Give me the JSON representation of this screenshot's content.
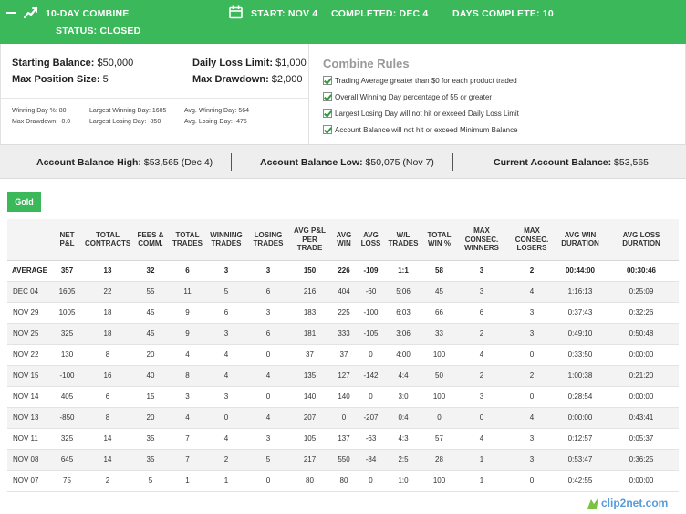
{
  "header": {
    "title": "10-DAY COMBINE",
    "status": "STATUS: CLOSED",
    "start": "START: NOV 4",
    "completed": "COMPLETED: DEC 4",
    "days_complete": "DAYS COMPLETE: 10"
  },
  "summary": {
    "starting_balance_label": "Starting Balance:",
    "starting_balance_value": " $50,000",
    "max_position_label": "Max Position Size:",
    "max_position_value": " 5",
    "daily_loss_label": "Daily Loss Limit:",
    "daily_loss_value": " $1,000",
    "max_drawdown_label": "Max Drawdown:",
    "max_drawdown_value": " $2,000",
    "winning_day_pct": "Winning Day %: 80",
    "max_drawdown_stat": "Max Drawdown: -0.0",
    "largest_winning_day": "Largest Winning Day: 1605",
    "largest_losing_day": "Largest Losing Day: -850",
    "avg_winning_day": "Avg. Winning Day: 564",
    "avg_losing_day": "Avg. Losing Day: -475"
  },
  "rules": {
    "title": "Combine Rules",
    "items": [
      "Trading Average greater than $0 for each product traded",
      "Overall Winning Day percentage of 55 or greater",
      "Largest Losing Day will not hit or exceed Daily Loss Limit",
      "Account Balance will not hit or exceed Minimum Balance"
    ]
  },
  "balances": {
    "high_label": "Account Balance High:",
    "high_value": " $53,565 (Dec 4)",
    "low_label": "Account Balance Low:",
    "low_value": " $50,075 (Nov 7)",
    "current_label": "Current Account Balance:",
    "current_value": " $53,565"
  },
  "product_button": "Gold",
  "table": {
    "headers": [
      "",
      "NET\nP&L",
      "TOTAL\nCONTRACTS",
      "FEES &\nCOMM.",
      "TOTAL\nTRADES",
      "WINNING\nTRADES",
      "LOSING\nTRADES",
      "AVG P&L\nPER\nTRADE",
      "AVG\nWIN",
      "AVG\nLOSS",
      "W/L\nTRADES",
      "TOTAL\nWIN %",
      "MAX\nCONSEC.\nWINNERS",
      "MAX\nCONSEC.\nLOSERS",
      "AVG WIN\nDURATION",
      "AVG LOSS\nDURATION"
    ],
    "rows": [
      [
        "AVERAGE",
        "357",
        "13",
        "32",
        "6",
        "3",
        "3",
        "150",
        "226",
        "-109",
        "1:1",
        "58",
        "3",
        "2",
        "00:44:00",
        "00:30:46"
      ],
      [
        "DEC 04",
        "1605",
        "22",
        "55",
        "11",
        "5",
        "6",
        "216",
        "404",
        "-60",
        "5:06",
        "45",
        "3",
        "4",
        "1:16:13",
        "0:25:09"
      ],
      [
        "NOV 29",
        "1005",
        "18",
        "45",
        "9",
        "6",
        "3",
        "183",
        "225",
        "-100",
        "6:03",
        "66",
        "6",
        "3",
        "0:37:43",
        "0:32:26"
      ],
      [
        "NOV 25",
        "325",
        "18",
        "45",
        "9",
        "3",
        "6",
        "181",
        "333",
        "-105",
        "3:06",
        "33",
        "2",
        "3",
        "0:49:10",
        "0:50:48"
      ],
      [
        "NOV 22",
        "130",
        "8",
        "20",
        "4",
        "4",
        "0",
        "37",
        "37",
        "0",
        "4:00",
        "100",
        "4",
        "0",
        "0:33:50",
        "0:00:00"
      ],
      [
        "NOV 15",
        "-100",
        "16",
        "40",
        "8",
        "4",
        "4",
        "135",
        "127",
        "-142",
        "4:4",
        "50",
        "2",
        "2",
        "1:00:38",
        "0:21:20"
      ],
      [
        "NOV 14",
        "405",
        "6",
        "15",
        "3",
        "3",
        "0",
        "140",
        "140",
        "0",
        "3:0",
        "100",
        "3",
        "0",
        "0:28:54",
        "0:00:00"
      ],
      [
        "NOV 13",
        "-850",
        "8",
        "20",
        "4",
        "0",
        "4",
        "207",
        "0",
        "-207",
        "0:4",
        "0",
        "0",
        "4",
        "0:00:00",
        "0:43:41"
      ],
      [
        "NOV 11",
        "325",
        "14",
        "35",
        "7",
        "4",
        "3",
        "105",
        "137",
        "-63",
        "4:3",
        "57",
        "4",
        "3",
        "0:12:57",
        "0:05:37"
      ],
      [
        "NOV 08",
        "645",
        "14",
        "35",
        "7",
        "2",
        "5",
        "217",
        "550",
        "-84",
        "2:5",
        "28",
        "1",
        "3",
        "0:53:47",
        "0:36:25"
      ],
      [
        "NOV 07",
        "75",
        "2",
        "5",
        "1",
        "1",
        "0",
        "80",
        "80",
        "0",
        "1:0",
        "100",
        "1",
        "0",
        "0:42:55",
        "0:00:00"
      ]
    ]
  },
  "watermark": "clip2net.com",
  "colors": {
    "accent": "#3bb85a",
    "check": "#2e9a3c",
    "muted_title": "#999999",
    "watermark": "#5a9bd8"
  },
  "icons": [
    "minus-icon",
    "chart-line-icon",
    "calendar-icon",
    "checkbox-checked-icon",
    "clip2net-logo-icon"
  ]
}
